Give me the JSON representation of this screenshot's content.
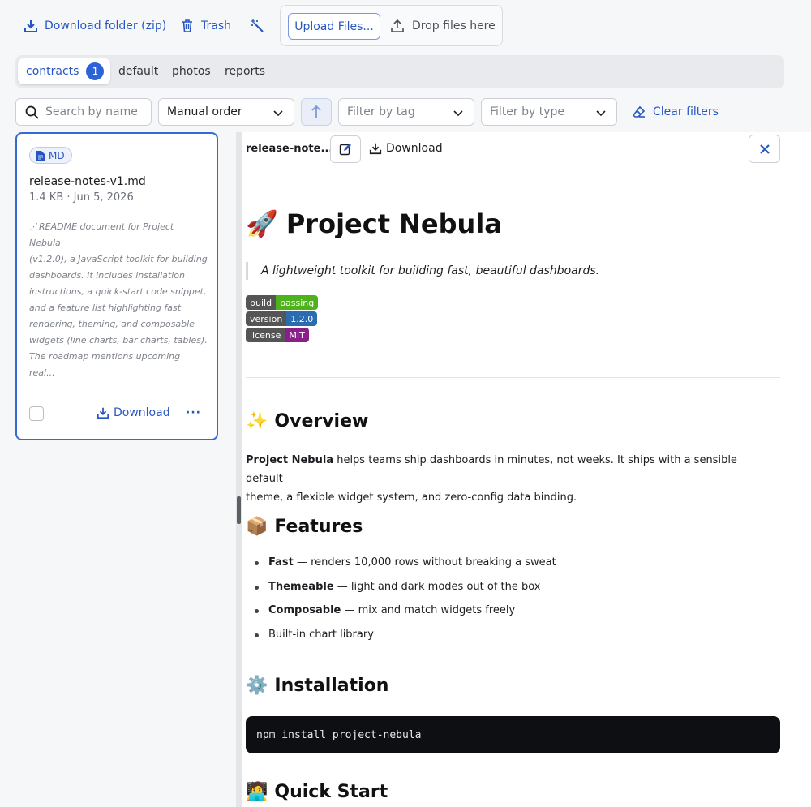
{
  "toolbar": {
    "download_folder": "Download folder (zip)",
    "trash": "Trash",
    "upload_files": "Upload Files...",
    "drop_files": "Drop files here"
  },
  "tabs": [
    {
      "label": "contracts",
      "badge": "1",
      "active": true
    },
    {
      "label": "default"
    },
    {
      "label": "photos"
    },
    {
      "label": "reports"
    }
  ],
  "filters": {
    "search_placeholder": "Search by name",
    "sort_value": "Manual order",
    "tag_placeholder": "Filter by tag",
    "type_placeholder": "Filter by type",
    "clear_filters": "Clear filters"
  },
  "card": {
    "file_type": "MD",
    "title": "release-notes-v1.md",
    "meta": "1.4 KB · Jun 5, 2026",
    "summary_lines": [
      "README document for Project Nebula",
      "(v1.2.0), a JavaScript toolkit for building",
      "dashboards. It includes installation",
      "instructions, a quick-start code snippet,",
      "and a feature list highlighting fast",
      "rendering, theming, and composable",
      "widgets (line charts, bar charts, tables).",
      "The roadmap mentions upcoming real..."
    ],
    "download": "Download",
    "more": "···"
  },
  "preview": {
    "file_name": "release-note...",
    "download": "Download",
    "doc": {
      "title_emoji": "🚀",
      "title": "Project Nebula",
      "tagline": "A lightweight toolkit for building fast, beautiful dashboards.",
      "badges": [
        {
          "key": "build",
          "value": "passing",
          "color": "#4c1"
        },
        {
          "key": "version",
          "value": "1.2.0",
          "color": "#2b6cb0"
        },
        {
          "key": "license",
          "value": "MIT",
          "color": "#8a1f8a"
        }
      ],
      "overview_emoji": "✨",
      "overview_heading": "Overview",
      "overview_bold": "Project Nebula",
      "overview_text_1": " helps teams ship dashboards in minutes, not weeks. It ships with a sensible default",
      "overview_text_2": "theme, a flexible widget system, and zero-config data binding.",
      "features_emoji": "📦",
      "features_heading": "Features",
      "features": [
        {
          "bold": "Fast",
          "text": " — renders 10,000 rows without breaking a sweat"
        },
        {
          "bold": "Themeable",
          "text": " — light and dark modes out of the box"
        },
        {
          "bold": "Composable",
          "text": " — mix and match widgets freely"
        },
        {
          "bold": "",
          "text": "Built-in chart library"
        }
      ],
      "install_emoji": "⚙️",
      "install_heading": "Installation",
      "install_code": "npm install project-nebula",
      "quickstart_emoji": "🧑‍💻",
      "quickstart_heading": "Quick Start"
    }
  },
  "colors": {
    "accent": "#2756c4",
    "card_border": "#3569d4"
  }
}
